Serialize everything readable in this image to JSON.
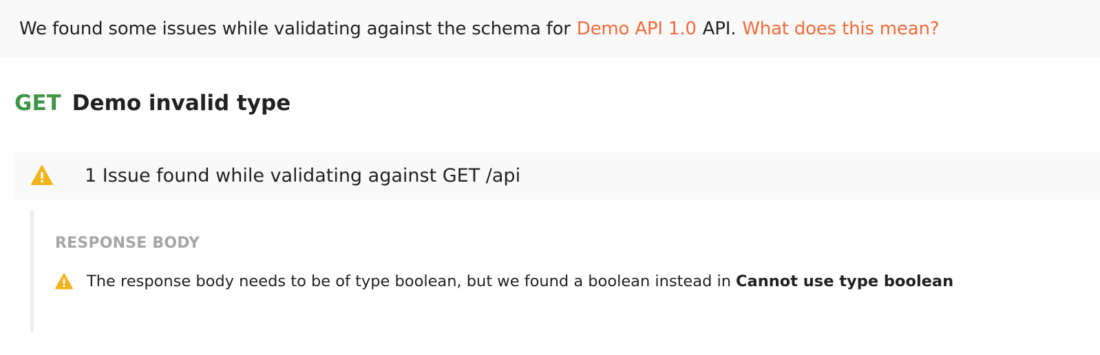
{
  "banner": {
    "prefix": "We found some issues while validating against the schema for",
    "api_link": "Demo API 1.0",
    "api_suffix": "API.",
    "help_link": "What does this mean?",
    "link_color": "#f26b3a"
  },
  "request": {
    "method": "GET",
    "name": "Demo invalid type",
    "method_color": "#3f9446"
  },
  "issues": {
    "summary": "1 Issue found while validating against GET /api",
    "icon": "warning-icon",
    "icon_color": "#f3b41b",
    "section_label": "RESPONSE BODY",
    "items": [
      {
        "message": "The response body needs to be of type boolean, but we found a boolean instead in",
        "detail": "Cannot use type boolean"
      }
    ]
  }
}
